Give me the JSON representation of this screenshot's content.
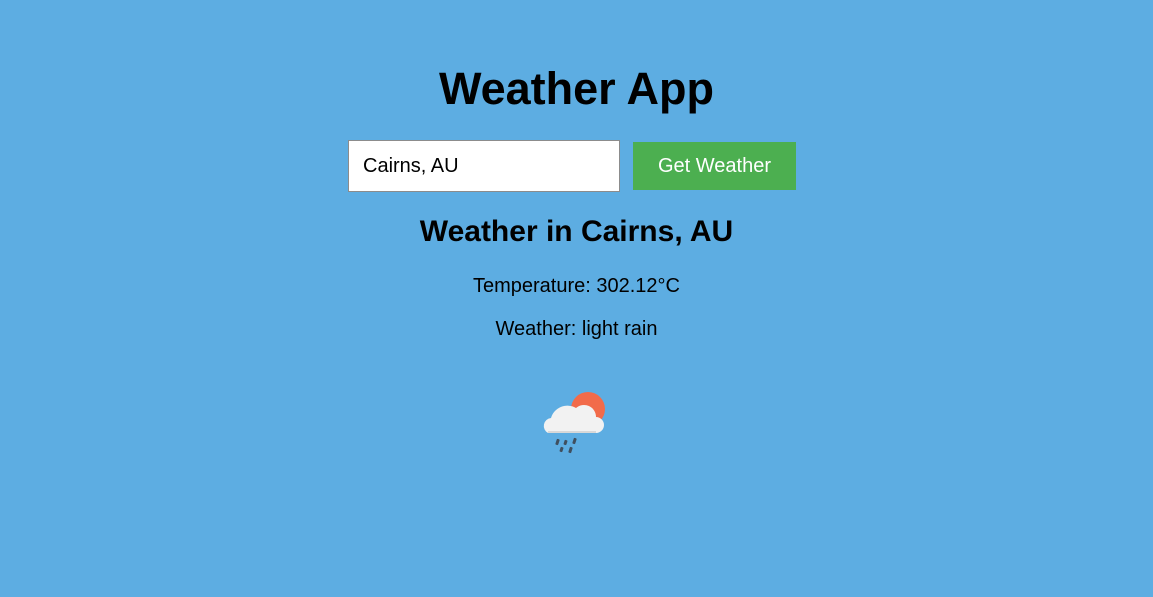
{
  "app": {
    "title": "Weather App"
  },
  "search": {
    "value": "Cairns, AU",
    "button_label": "Get Weather"
  },
  "result": {
    "heading": "Weather in Cairns, AU",
    "temperature": "Temperature: 302.12°C",
    "weather": "Weather: light rain",
    "icon": "light-rain-sun-cloud-icon"
  },
  "colors": {
    "background": "#5dade2",
    "button": "#4caf50",
    "button_text": "#ffffff",
    "sun": "#f26b4a",
    "cloud": "#f2f2f2"
  }
}
